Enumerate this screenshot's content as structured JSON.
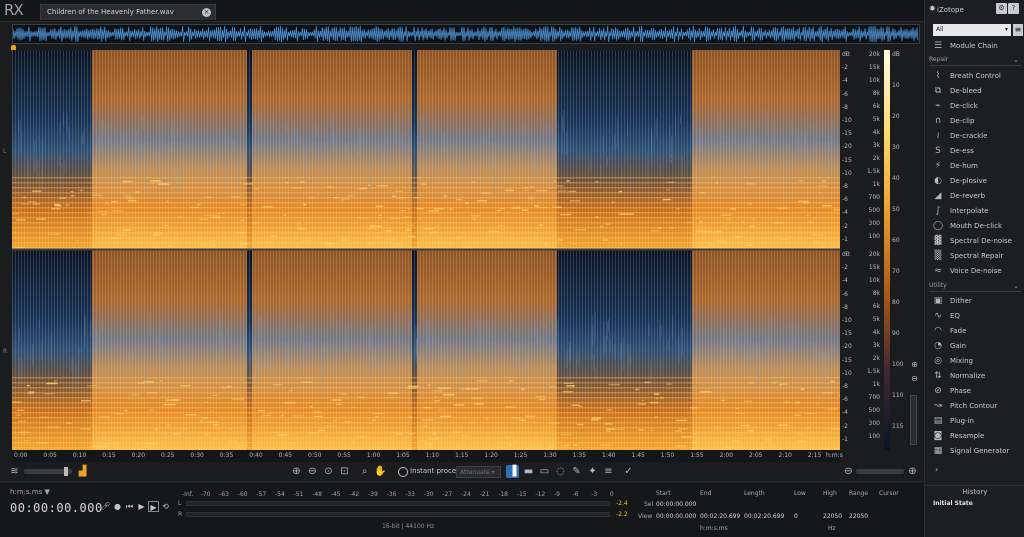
{
  "app": {
    "logo": "RX",
    "brand": "iZotope"
  },
  "file_tab": {
    "name": "Children of the Heavenly Father.wav",
    "close": "×"
  },
  "channels": [
    "L",
    "R"
  ],
  "freq_axis": [
    "dB",
    "-2",
    "-4",
    "-6",
    "-8",
    "-10",
    "-15",
    "-20",
    "-15",
    "-10",
    "-8",
    "-6",
    "-4",
    "-2",
    "-1"
  ],
  "hz_axis_top": [
    "20k",
    "15k",
    "10k",
    "8k",
    "6k",
    "5k",
    "4k",
    "3k",
    "2k",
    "1.5k",
    "1k",
    "700",
    "500",
    "300",
    "100"
  ],
  "hz_axis_bottom": [
    "20k",
    "15k",
    "10k",
    "8k",
    "6k",
    "5k",
    "4k",
    "3k",
    "2k",
    "1.5k",
    "1k",
    "700",
    "500",
    "300",
    "100"
  ],
  "db_axis": [
    "dB",
    "10",
    "20",
    "30",
    "40",
    "50",
    "60",
    "70",
    "80",
    "90",
    "100",
    "110",
    "115"
  ],
  "time_axis": [
    "0:00",
    "0:05",
    "0:10",
    "0:15",
    "0:20",
    "0:25",
    "0:30",
    "0:35",
    "0:40",
    "0:45",
    "0:50",
    "0:55",
    "1:00",
    "1:05",
    "1:10",
    "1:15",
    "1:20",
    "1:25",
    "1:30",
    "1:35",
    "1:40",
    "1:45",
    "1:50",
    "1:55",
    "2:00",
    "2:05",
    "2:10",
    "2:15"
  ],
  "time_unit": "h:m:s",
  "toolbar": {
    "instant_process": "Instant process",
    "attenuate": "Attenuate"
  },
  "transport": {
    "time_format": "h:m:s.ms ▼",
    "time": "00:00:00.000"
  },
  "meter": {
    "labels": [
      "-Inf.",
      "-70",
      "-63",
      "-60",
      "-57",
      "-54",
      "-51",
      "-48",
      "-45",
      "-42",
      "-39",
      "-36",
      "-33",
      "-30",
      "-27",
      "-24",
      "-21",
      "-18",
      "-15",
      "-12",
      "-9",
      "-6",
      "-3",
      "0"
    ],
    "peak_l": "-2.4",
    "peak_r": "-2.2",
    "ch_l": "L",
    "ch_r": "R",
    "format": "16-bit | 44100 Hz"
  },
  "selection": {
    "headers": [
      "Start",
      "End",
      "Length",
      "Low",
      "High",
      "Range",
      "Cursor"
    ],
    "sel_label": "Sel",
    "view_label": "View",
    "sel_start": "00:00:00.000",
    "view_start": "00:00:00.000",
    "view_end": "00:02:20.699",
    "view_length": "00:02:20.699",
    "low": "0",
    "high": "22050",
    "range": "22050",
    "unit_time": "h:m:s.ms",
    "unit_hz": "Hz"
  },
  "panel": {
    "filter": "All",
    "module_chain": "Module Chain",
    "repair_label": "Repair",
    "repair_items": [
      "Breath Control",
      "De-bleed",
      "De-click",
      "De-clip",
      "De-crackle",
      "De-ess",
      "De-hum",
      "De-plosive",
      "De-reverb",
      "Interpolate",
      "Mouth De-click",
      "Spectral De-noise",
      "Spectral Repair",
      "Voice De-noise"
    ],
    "utility_label": "Utility",
    "utility_items": [
      "Dither",
      "EQ",
      "Fade",
      "Gain",
      "Mixing",
      "Normalize",
      "Phase",
      "Pitch Contour",
      "Plug-in",
      "Resample",
      "Signal Generator"
    ],
    "history_title": "History",
    "history_item": "Initial State"
  }
}
